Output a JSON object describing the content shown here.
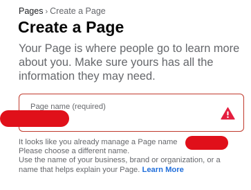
{
  "breadcrumb": {
    "root": "Pages",
    "separator": "›",
    "current": "Create a Page"
  },
  "header": {
    "title": "Create a Page",
    "subtitle": "Your Page is where people go to learn more about you. Make sure yours has all the information they may need."
  },
  "page_name_field": {
    "label": "Page name (required)",
    "value": "",
    "state": "error",
    "icon": "warning-triangle-icon",
    "error_color": "#e41e3f"
  },
  "helper": {
    "error_line1": "It looks like you already manage a Page name",
    "error_line2": "Please choose a different name.",
    "hint_line1": "Use the name of your business, brand or organization, or a",
    "hint_line2": "name that helps explain your Page.",
    "learn_more": "Learn More"
  },
  "colors": {
    "link": "#216fdb",
    "border_error": "#c0392b",
    "redaction": "#e0101a"
  }
}
